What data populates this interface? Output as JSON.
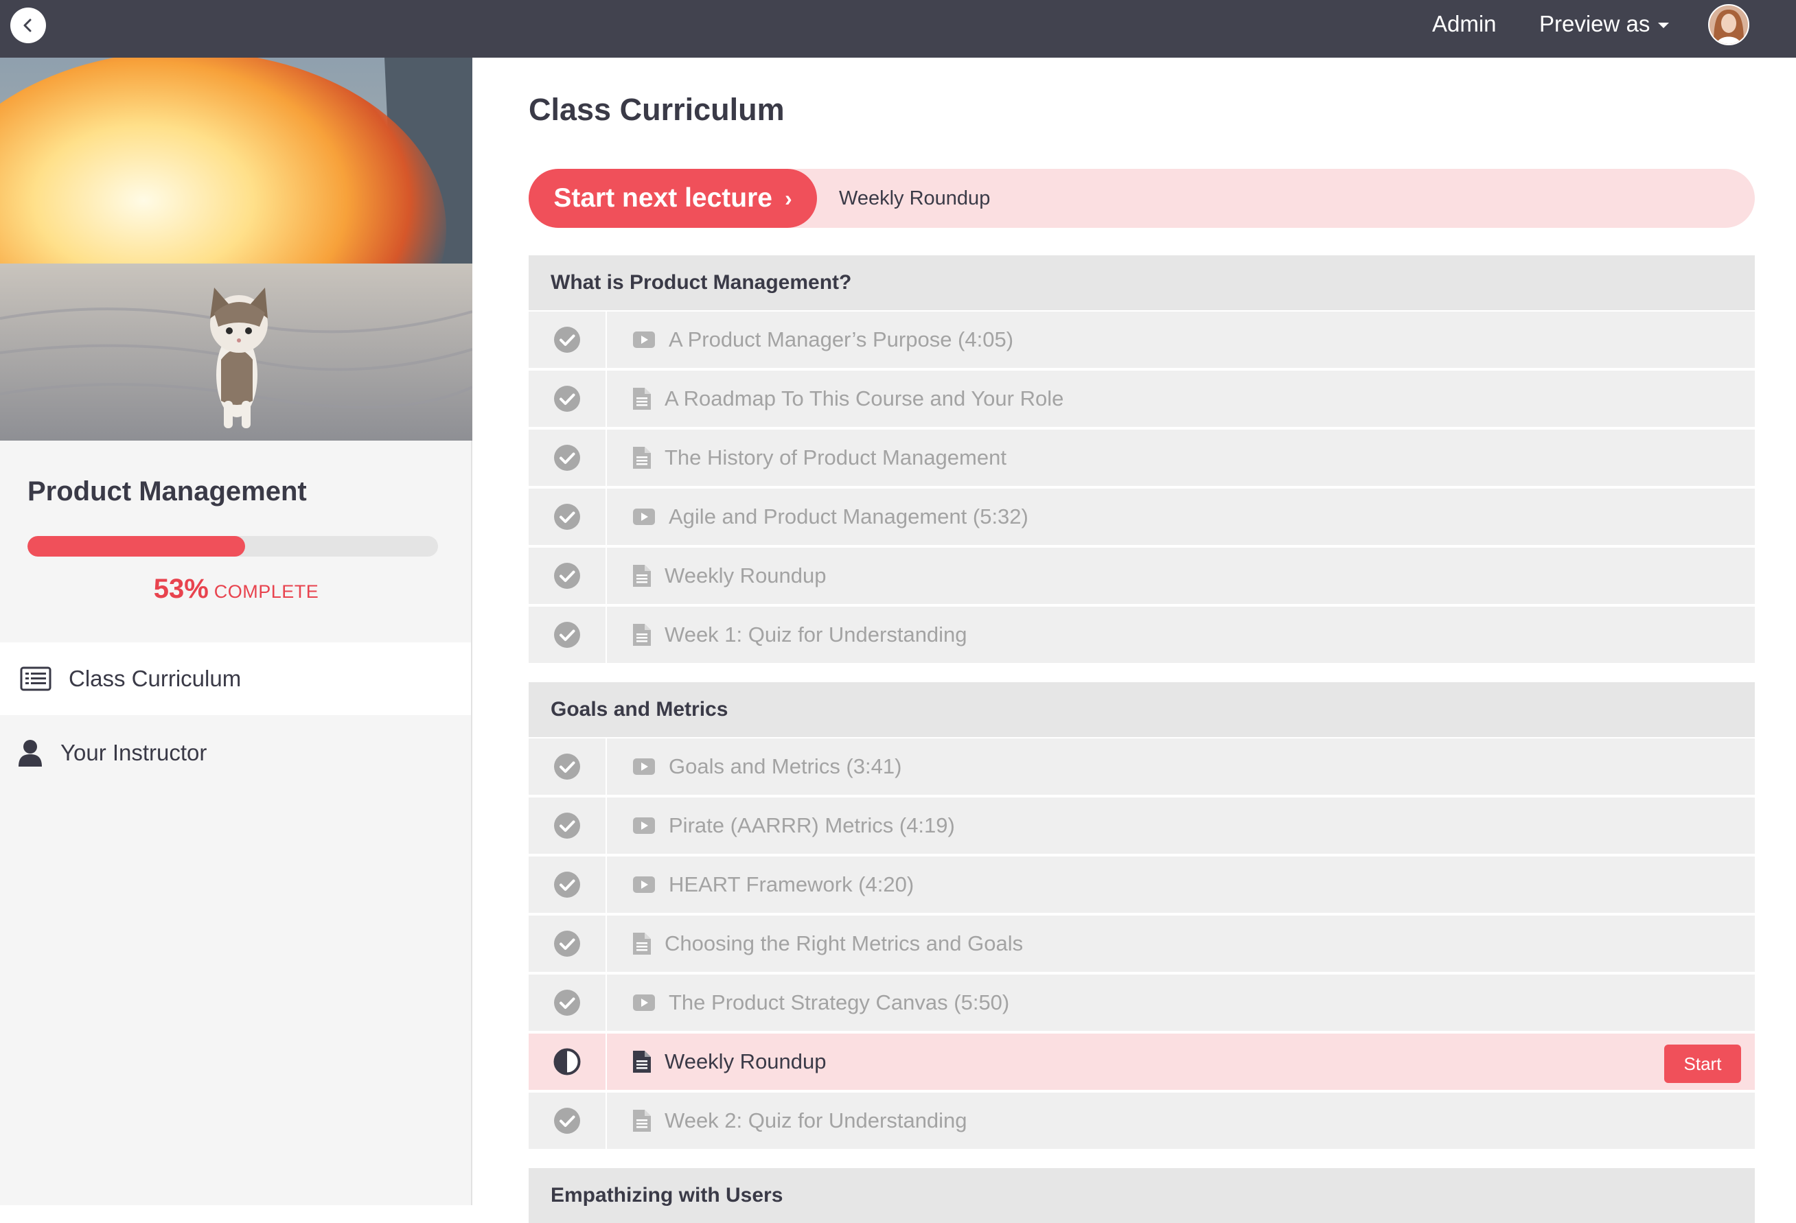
{
  "topbar": {
    "admin_label": "Admin",
    "preview_label": "Preview as",
    "back_icon": "chevron-left-icon"
  },
  "sidebar": {
    "course_title": "Product Management",
    "progress": {
      "percent": 53,
      "percent_text": "53%",
      "label": "COMPLETE"
    },
    "items": [
      {
        "label": "Class Curriculum",
        "icon": "list-icon",
        "active": true
      },
      {
        "label": "Your Instructor",
        "icon": "user-icon",
        "active": false
      }
    ]
  },
  "main": {
    "title": "Class Curriculum",
    "next_lecture": {
      "button_label": "Start next lecture",
      "lecture_name": "Weekly Roundup"
    },
    "sections": [
      {
        "title": "What is Product Management?",
        "lectures": [
          {
            "title": "A Product Manager’s Purpose (4:05)",
            "type": "video",
            "status": "complete"
          },
          {
            "title": "A Roadmap To This Course and Your Role",
            "type": "document",
            "status": "complete"
          },
          {
            "title": "The History of Product Management",
            "type": "document",
            "status": "complete"
          },
          {
            "title": "Agile and Product Management (5:32)",
            "type": "video",
            "status": "complete"
          },
          {
            "title": "Weekly Roundup",
            "type": "document",
            "status": "complete"
          },
          {
            "title": "Week 1: Quiz for Understanding",
            "type": "document",
            "status": "complete"
          }
        ]
      },
      {
        "title": "Goals and Metrics",
        "lectures": [
          {
            "title": "Goals and Metrics (3:41)",
            "type": "video",
            "status": "complete"
          },
          {
            "title": "Pirate (AARRR) Metrics (4:19)",
            "type": "video",
            "status": "complete"
          },
          {
            "title": "HEART Framework (4:20)",
            "type": "video",
            "status": "complete"
          },
          {
            "title": "Choosing the Right Metrics and Goals",
            "type": "document",
            "status": "complete"
          },
          {
            "title": "The Product Strategy Canvas (5:50)",
            "type": "video",
            "status": "complete"
          },
          {
            "title": "Weekly Roundup",
            "type": "document",
            "status": "in-progress",
            "action_label": "Start"
          },
          {
            "title": "Week 2: Quiz for Understanding",
            "type": "document",
            "status": "complete"
          }
        ]
      },
      {
        "title": "Empathizing with Users",
        "lectures": []
      }
    ]
  },
  "colors": {
    "accent": "#f0505a",
    "accent_light": "#fbdfe1",
    "topbar": "#42434f",
    "text_dark": "#3a3a47",
    "text_muted": "#a3a3a3"
  }
}
